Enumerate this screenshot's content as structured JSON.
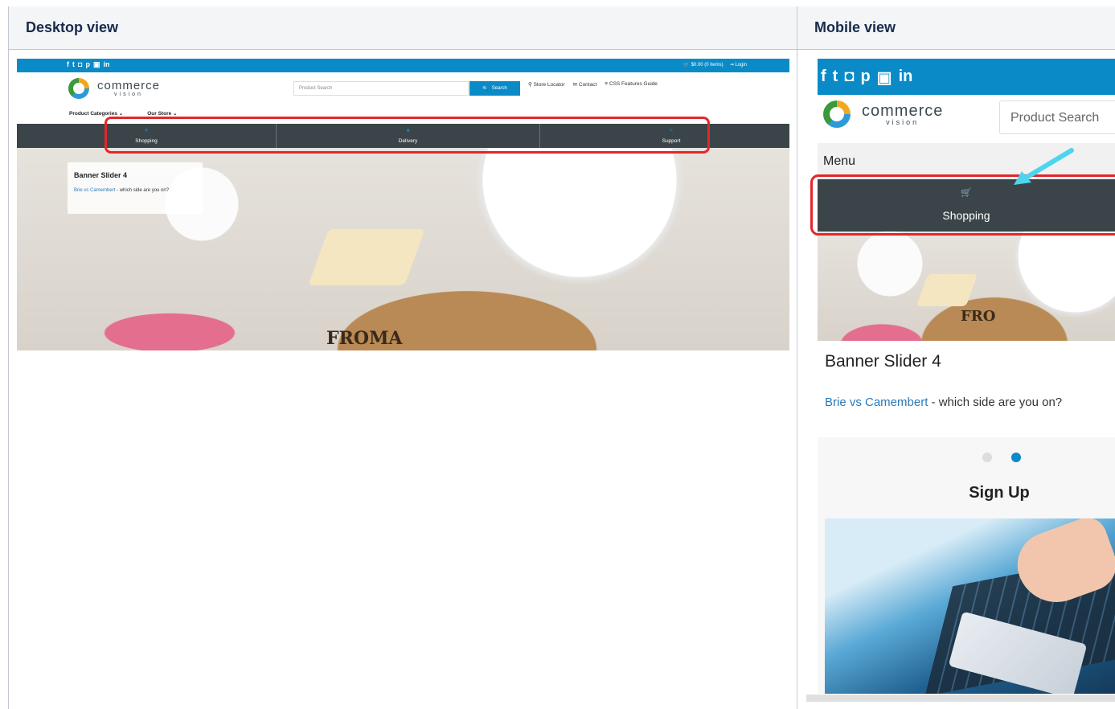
{
  "table": {
    "col1_header": "Desktop view",
    "col2_header": "Mobile view"
  },
  "colors": {
    "brand_blue": "#0a8bc7",
    "menu_dark": "#3b4549",
    "highlight_red": "#e4262c",
    "arrow_cyan": "#4dd5ee"
  },
  "desktop": {
    "social_icons": [
      "facebook-icon",
      "twitter-icon",
      "instagram-icon",
      "pinterest-icon",
      "youtube-icon",
      "linkedin-icon"
    ],
    "cart_text": "$0.00 (0 items)",
    "login_label": "Login",
    "logo_main": "commerce",
    "logo_sub": "vision",
    "search_placeholder": "Product Search",
    "search_button": "Search",
    "links": [
      "Store Locator",
      "Contact",
      "CSS Features Guide"
    ],
    "nav": [
      "Product Categories",
      "Our Store"
    ],
    "menu": [
      "Shopping",
      "Delivery",
      "Support"
    ],
    "banner_title": "Banner Slider 4",
    "banner_link": "Brie vs Camembert",
    "banner_rest": " - which side are you on?",
    "board_text": "FROMA"
  },
  "mobile": {
    "social_icons": [
      "facebook-icon",
      "twitter-icon",
      "instagram-icon",
      "pinterest-icon",
      "youtube-icon",
      "linkedin-icon"
    ],
    "logo_main": "commerce",
    "logo_sub": "vision",
    "search_placeholder": "Product Search",
    "menu_label": "Menu",
    "menu_item": "Shopping",
    "board_text": "FRO",
    "banner_title": "Banner Slider 4",
    "banner_link": "Brie vs Camembert",
    "banner_rest": " - which side are you on?",
    "signup_title": "Sign Up"
  }
}
